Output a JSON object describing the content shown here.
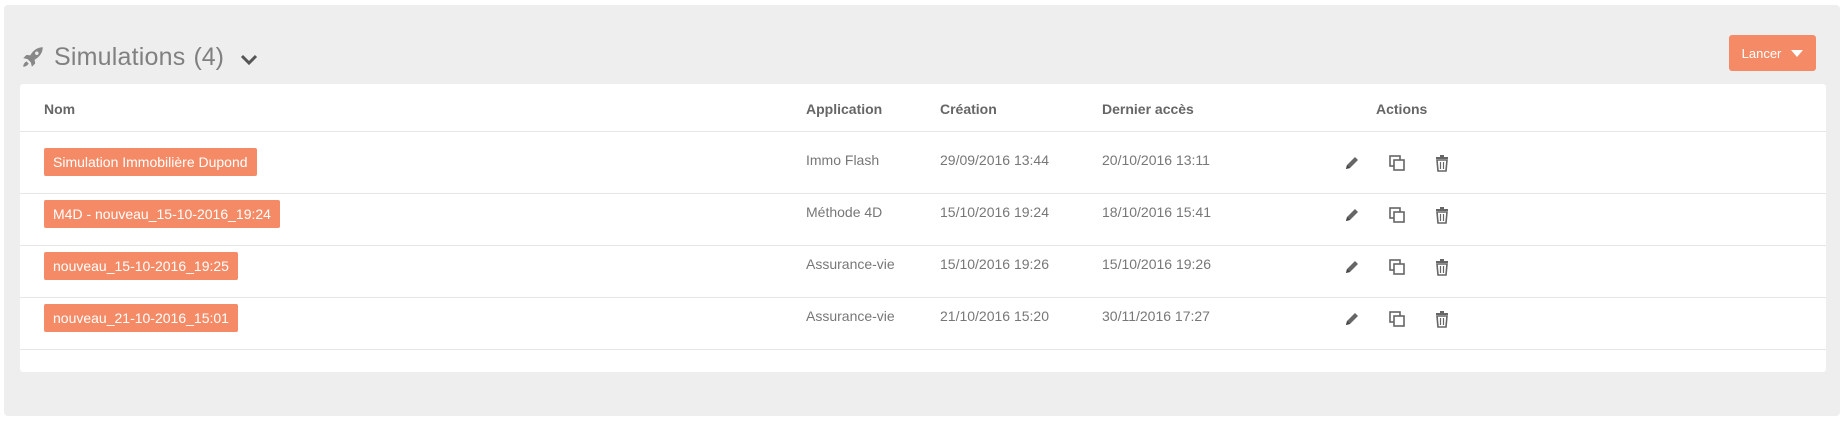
{
  "header": {
    "title": "Simulations",
    "count": "(4)"
  },
  "launch_button": {
    "label": "Lancer"
  },
  "table": {
    "columns": {
      "name": "Nom",
      "application": "Application",
      "creation": "Création",
      "last_access": "Dernier accès",
      "actions": "Actions"
    },
    "rows": [
      {
        "name": "Simulation Immobilière Dupond",
        "application": "Immo Flash",
        "creation": "29/09/2016 13:44",
        "last_access": "20/10/2016 13:11"
      },
      {
        "name": "M4D - nouveau_15-10-2016_19:24",
        "application": "Méthode 4D",
        "creation": "15/10/2016 19:24",
        "last_access": "18/10/2016 15:41"
      },
      {
        "name": "nouveau_15-10-2016_19:25",
        "application": "Assurance-vie",
        "creation": "15/10/2016 19:26",
        "last_access": "15/10/2016 19:26"
      },
      {
        "name": "nouveau_21-10-2016_15:01",
        "application": "Assurance-vie",
        "creation": "21/10/2016 15:20",
        "last_access": "30/11/2016 17:27"
      }
    ]
  },
  "colors": {
    "accent": "#f58b66",
    "panel_bg": "#eeeeee",
    "icon": "#666666"
  },
  "icons": {
    "header": "rocket-icon",
    "expand": "chevron-down-icon",
    "edit": "pencil-icon",
    "copy": "copy-icon",
    "delete": "trash-icon"
  }
}
